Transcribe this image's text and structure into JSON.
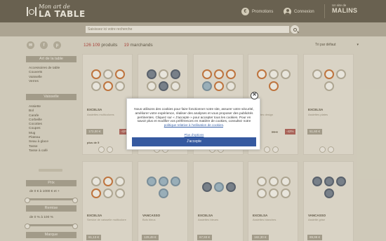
{
  "header": {
    "logo_line1": "Mon art de",
    "logo_line2": "LA TABLE",
    "promotions_label": "Promotions",
    "promo_icon": "€",
    "connexion_label": "Connexion",
    "partner_small": "Un site de",
    "partner_brand": "MALINS"
  },
  "search": {
    "placeholder": "Saisissez ici votre recherche"
  },
  "social": {
    "icons": [
      "mail-icon",
      "facebook-icon",
      "pinterest-icon"
    ],
    "glyphs": [
      "✉",
      "f",
      "p"
    ]
  },
  "sidebar": {
    "art_header": "Art de la table",
    "art_items": [
      "Accessoires de table",
      "Couverts",
      "Vaisselle",
      "Verres"
    ],
    "vaisselle_header": "Vaisselle",
    "vaisselle_items": [
      "Assiette",
      "Bol",
      "Carafe",
      "Corbeille",
      "Cocottes",
      "Coupes",
      "Mug",
      "Plateau",
      "Seau à glace",
      "Tasse",
      "Tasse à café"
    ],
    "prix_header": "Prix",
    "prix_range": "de 0 € à 1000 € et +",
    "remise_header": "Remise",
    "remise_range": "de 0 % à 100 %",
    "marque_header": "Marque"
  },
  "results": {
    "count": "126 109",
    "count_label": "produits",
    "merchants": "19",
    "merchants_label": "marchands",
    "sort_label": "Tri par défaut",
    "sort_chevron": "▾"
  },
  "products": [
    {
      "brand": "EXCELSA",
      "desc": "Assiettes multicolores",
      "price": "172,00 €",
      "old": "",
      "disc": "-42%",
      "more": "plus de 5"
    },
    {
      "brand": "",
      "desc": "",
      "price": "",
      "old": "",
      "disc": "",
      "more": ""
    },
    {
      "brand": "",
      "desc": "",
      "price": "",
      "old": "",
      "disc": "",
      "more": ""
    },
    {
      "brand": "",
      "desc": "Assiettes design",
      "price": "",
      "old": "89 €",
      "disc": "-42%",
      "more": ""
    },
    {
      "brand": "EXCELSA",
      "desc": "Assiettes plates",
      "price": "51,60 €",
      "old": "",
      "disc": "",
      "more": ""
    },
    {
      "brand": "EXCELSA",
      "desc": "Service de vaisselle multicolore",
      "price": "61,13 €",
      "old": "",
      "disc": "",
      "more": ""
    },
    {
      "brand": "VANCASSO",
      "desc": "Bols bleus",
      "price": "129,49 €",
      "old": "",
      "disc": "",
      "more": ""
    },
    {
      "brand": "EXCELSA",
      "desc": "Assiettes bleues",
      "price": "67,93 €",
      "old": "",
      "disc": "",
      "more": ""
    },
    {
      "brand": "EXCELSA",
      "desc": "Assiettes blanches",
      "price": "182,30 €",
      "old": "",
      "disc": "",
      "more": ""
    },
    {
      "brand": "VANCASSO",
      "desc": "Assiette grise",
      "price": "89,99 €",
      "old": "",
      "disc": "",
      "more": ""
    }
  ],
  "cookie": {
    "text": "Nous utilisons des cookies pour faire fonctionner notre site, assurer votre sécurité, améliorer votre expérience, réaliser des analyses et vous proposer des publicités pertinentes. Cliquez sur « J'accepte » pour accepter tous les cookies. Pour en savoir plus et modifier vos préférences en matière de cookies, consultez notre",
    "policy_link": "politique relative à l'utilisation de cookies",
    "more_options": "Plus d'options",
    "accept_label": "J'accepte",
    "close_glyph": "✕"
  },
  "colors": {
    "header_bg": "#6b6352",
    "accent_red": "#b2483e",
    "accept_blue": "#3559a0"
  }
}
